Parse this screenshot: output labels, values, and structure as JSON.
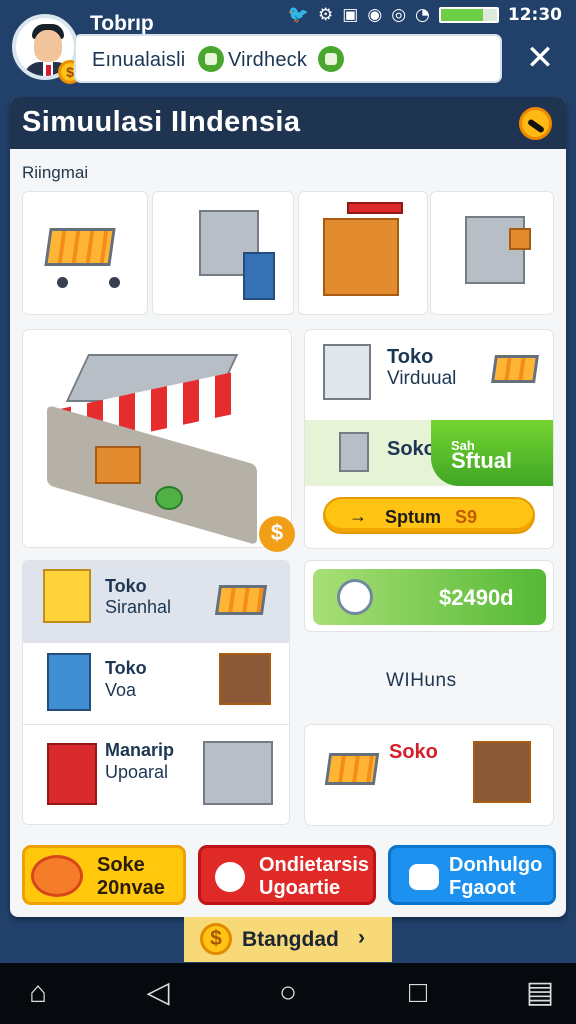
{
  "status": {
    "username": "Tobrıp",
    "time": "12:30",
    "icons": [
      "twitter-icon",
      "settings-icon",
      "message-icon",
      "alarm-icon",
      "record-icon",
      "wifi-icon",
      "signal-icon",
      "battery-icon"
    ]
  },
  "header": {
    "search_text": "Eınualaisli",
    "verified_text": "Virdheck"
  },
  "game": {
    "title": "Simuulasi IIndensia",
    "section": "Riingmai",
    "cards": {
      "toko_virtual_title": "Toko",
      "toko_virtual_sub": "Virduual",
      "soko_title": "Soko",
      "soko_sub": "Sftual",
      "soko_small": "Sah",
      "price_label": "Sptum",
      "price_value": "S9",
      "money_value": "$2490d",
      "store1_title": "Toko",
      "store1_sub": "Siranhal",
      "store2_title": "Toko",
      "store2_sub": "Voa",
      "store3_title": "Manarip",
      "store3_sub": "Upoaral",
      "vendor_label": "WIHuns",
      "soko_bottom": "Soko"
    },
    "buttons": {
      "yellow_line1": "Soke",
      "yellow_line2": "20nvae",
      "red_line1": "Ondietarsis",
      "red_line2": "Ugoartie",
      "blue_line1": "Donhulgo",
      "blue_line2": "Fgaoot"
    },
    "bottom_strip": "Btangdad"
  },
  "colors": {
    "background": "#21416a",
    "panel": "#1e3450",
    "yellow": "#ffc313",
    "green": "#55b935",
    "red": "#e02a28",
    "blue": "#1d91f0"
  }
}
